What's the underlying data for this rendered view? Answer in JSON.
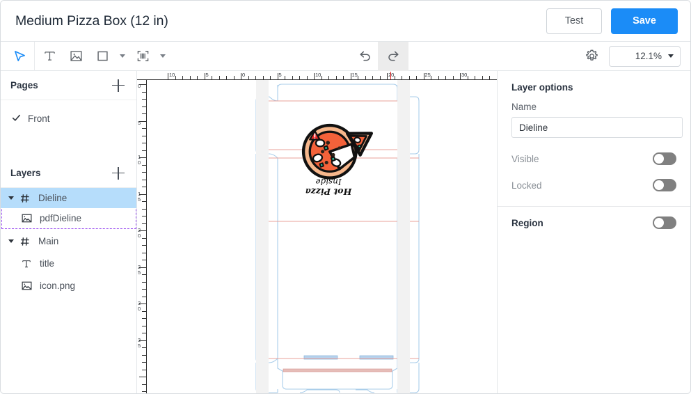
{
  "header": {
    "title": "Medium Pizza Box (12 in)",
    "test_label": "Test",
    "save_label": "Save"
  },
  "toolbar": {
    "tools": [
      {
        "name": "select-tool",
        "icon": "cursor-arrow-icon",
        "active": true
      },
      {
        "name": "text-tool",
        "icon": "text-icon",
        "active": false
      },
      {
        "name": "image-tool",
        "icon": "image-icon",
        "active": false
      },
      {
        "name": "shape-tool",
        "icon": "rectangle-icon",
        "active": false
      },
      {
        "name": "barcode-tool",
        "icon": "barcode-icon",
        "active": false
      }
    ],
    "undo_icon": "undo-icon",
    "redo_icon": "redo-icon",
    "settings_icon": "gear-icon",
    "zoom_level": "12.1%"
  },
  "left_panel": {
    "pages": {
      "title": "Pages",
      "add_label": "+",
      "items": [
        {
          "label": "Front",
          "checked": true
        }
      ]
    },
    "layers": {
      "title": "Layers",
      "add_label": "+",
      "items": [
        {
          "label": "Dieline",
          "type": "group",
          "icon": "group-icon",
          "depth": 0,
          "selected": true,
          "expanded": true
        },
        {
          "label": "pdfDieline",
          "type": "image",
          "icon": "image-icon",
          "depth": 1,
          "selected": false,
          "expanded": false
        },
        {
          "label": "Main",
          "type": "group",
          "icon": "group-icon",
          "depth": 0,
          "selected": false,
          "expanded": true
        },
        {
          "label": "title",
          "type": "text",
          "icon": "text-icon",
          "depth": 1,
          "selected": false,
          "expanded": false
        },
        {
          "label": "icon.png",
          "type": "image",
          "icon": "image-icon",
          "depth": 1,
          "selected": false,
          "expanded": false
        }
      ]
    }
  },
  "right_panel": {
    "layer_options_title": "Layer options",
    "name_label": "Name",
    "name_value": "Dieline",
    "visible_label": "Visible",
    "visible_on": false,
    "locked_label": "Locked",
    "locked_on": false,
    "region_label": "Region",
    "region_on": false
  },
  "canvas": {
    "ruler_h_labels": [
      "10",
      "5",
      "0",
      "5",
      "10",
      "15",
      "20",
      "25",
      "30"
    ],
    "ruler_v_labels": [
      "0",
      "5",
      "10",
      "15",
      "20",
      "25",
      "30",
      "35"
    ],
    "artwork": {
      "headline": "Hot Pizza",
      "subline": "Inside",
      "icon": "pizza-icon"
    },
    "colors": {
      "cut_line": "#a9cdea",
      "fold_line": "#e8a09a",
      "tab_fill": "#b7d3ee",
      "accent": "#1b8cf7",
      "selection": "#b6ddfb",
      "selection_border": "#9b4ff0"
    }
  }
}
